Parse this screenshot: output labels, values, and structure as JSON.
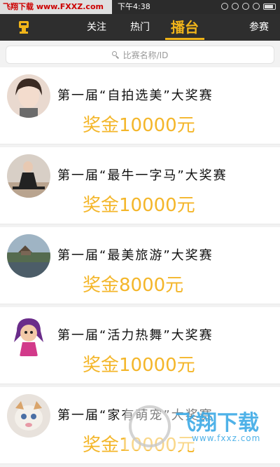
{
  "status": {
    "watermark_text": "飞翔下载  www.FXXZ.com",
    "time": "下午4:38"
  },
  "nav": {
    "tabs": [
      "关注",
      "热门",
      "播台"
    ],
    "active_tab": "播台",
    "right_label": "参赛"
  },
  "search": {
    "placeholder": "比赛名称/ID"
  },
  "contests": [
    {
      "title": "第一届“自拍选美”大奖赛",
      "prize": "奖金10000元"
    },
    {
      "title": "第一届“最牛一字马”大奖赛",
      "prize": "奖金10000元"
    },
    {
      "title": "第一届“最美旅游”大奖赛",
      "prize": "奖金8000元"
    },
    {
      "title": "第一届“活力热舞”大奖赛",
      "prize": "奖金10000元"
    },
    {
      "title": "第一届“家有萌宠”大奖赛",
      "prize": "奖金10000元"
    }
  ],
  "watermark": {
    "brand": "飞翔下载",
    "url": "www.fxxz.com"
  },
  "colors": {
    "accent": "#f0b41a",
    "prize": "#f4b62a",
    "nav_bg": "#2e2e2e"
  }
}
